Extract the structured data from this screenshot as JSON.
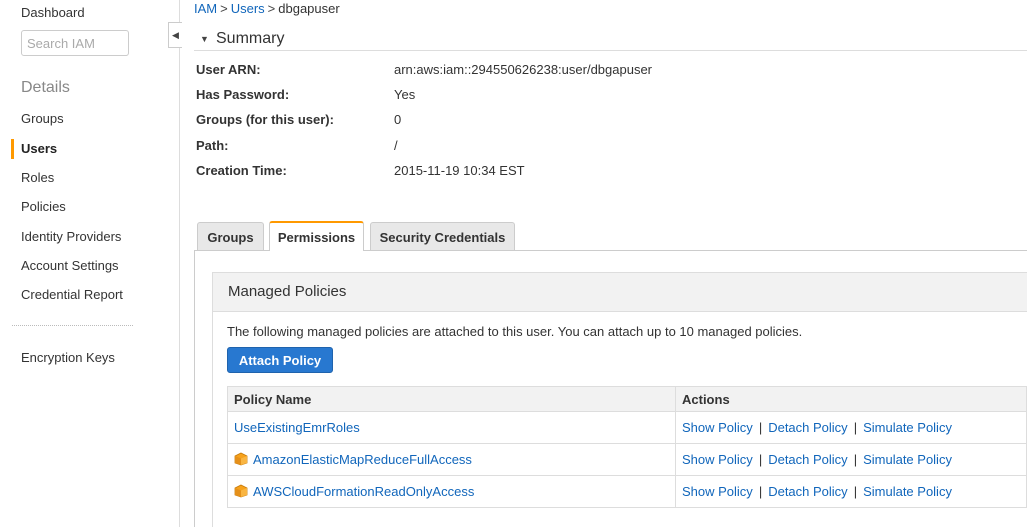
{
  "sidebar": {
    "dashboard": "Dashboard",
    "search_placeholder": "Search IAM",
    "details_heading": "Details",
    "items": [
      {
        "label": "Groups"
      },
      {
        "label": "Users"
      },
      {
        "label": "Roles"
      },
      {
        "label": "Policies"
      },
      {
        "label": "Identity Providers"
      },
      {
        "label": "Account Settings"
      },
      {
        "label": "Credential Report"
      }
    ],
    "encryption_keys": "Encryption Keys"
  },
  "breadcrumb": {
    "root": "IAM",
    "sep": ">",
    "users": "Users",
    "current": "dbgapuser"
  },
  "summary": {
    "title": "Summary",
    "rows": [
      {
        "label": "User ARN:",
        "value": "arn:aws:iam::294550626238:user/dbgapuser"
      },
      {
        "label": "Has Password:",
        "value": "Yes"
      },
      {
        "label": "Groups (for this user):",
        "value": "0"
      },
      {
        "label": "Path:",
        "value": "/"
      },
      {
        "label": "Creation Time:",
        "value": "2015-11-19 10:34 EST"
      }
    ]
  },
  "tabs": [
    {
      "label": "Groups"
    },
    {
      "label": "Permissions"
    },
    {
      "label": "Security Credentials"
    }
  ],
  "managed_policies": {
    "title": "Managed Policies",
    "description": "The following managed policies are attached to this user. You can attach up to 10 managed policies.",
    "attach_button": "Attach Policy",
    "columns": {
      "name": "Policy Name",
      "actions": "Actions"
    },
    "actions": {
      "show": "Show Policy",
      "detach": "Detach Policy",
      "simulate": "Simulate Policy",
      "sep": "|"
    },
    "rows": [
      {
        "name": "UseExistingEmrRoles",
        "icon": "none"
      },
      {
        "name": "AmazonElasticMapReduceFullAccess",
        "icon": "aws-cube-icon"
      },
      {
        "name": "AWSCloudFormationReadOnlyAccess",
        "icon": "aws-cube-icon"
      }
    ]
  },
  "colors": {
    "accent": "#ff9900",
    "link": "#1166bb",
    "button": "#2878d0"
  }
}
